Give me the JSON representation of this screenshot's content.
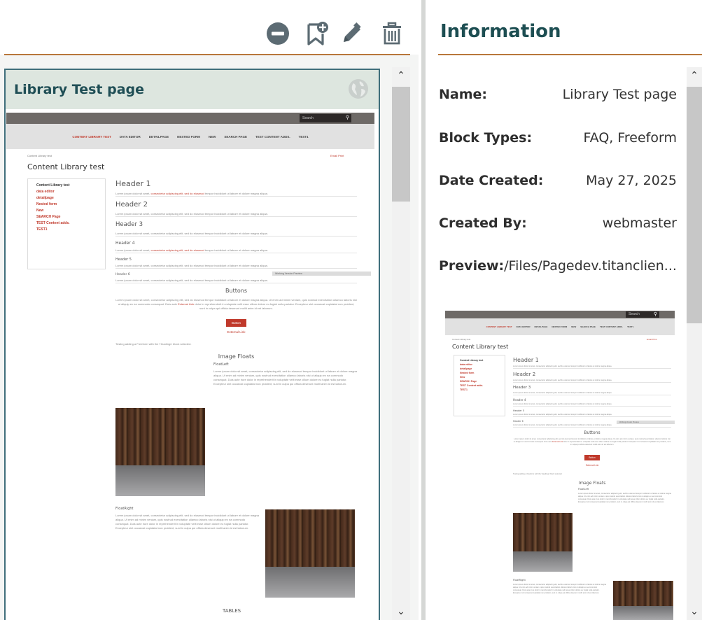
{
  "toolbar": {
    "icons": [
      "minus-circle-icon",
      "bookmark-add-icon",
      "pencil-icon",
      "trash-icon"
    ]
  },
  "card": {
    "title": "Library Test page",
    "globe_icon": "globe-icon"
  },
  "site": {
    "search_placeholder": "Search",
    "search_icon_glyph": "⚲",
    "nav": [
      "CONTENT LIBRARY TEST",
      "DATA EDITOR",
      "DETAILPAGE",
      "NESTED FORM",
      "NEW",
      "SEARCH PAGE",
      "TEST CONTENT ADDS.",
      "TEST1"
    ],
    "breadcrumb": "Content Library test",
    "utility": "Email  Print",
    "page_title": "Content Library test",
    "sidebar": [
      "Content Library test",
      "data editor",
      "detailpage",
      "Nested form",
      "New",
      "SEARCH Page",
      "TEST Content adds.",
      "TEST1"
    ],
    "headers": [
      "Header 1",
      "Header 2",
      "Header 3",
      "Header 4",
      "Header 5",
      "Header 6"
    ],
    "lorem_plain": "Lorem ipsum dolor sit amet,",
    "lorem_link": "consectetur adipiscing elit, sed do eiusmod",
    "lorem_rest": "tempor incididunt ut labore et dolore magna aliqua.",
    "lorem_full": "Lorem ipsum dolor sit amet, consectetur adipiscing elit, sed do eiusmod tempor incididunt ut labore et dolore magna aliqua.",
    "buttons_heading": "Buttons",
    "buttons_text_a": "Lorem ipsum dolor sit amet, consectetur adipiscing elit, sed do eiusmod tempor incididunt ut labore et dolore magna aliqua. Ut enim ad minim veniam, quis nostrud exercitation ullamco laboris nisi ut aliquip ex ea commodo consequat. Duis aute",
    "buttons_text_link": "External Link",
    "buttons_text_b": "dolor in reprehenderit in voluptate velit esse cillum dolore eu fugiat nulla pariatur. Excepteur sint occaecat cupidatat non proident, sunt in culpa qui officia deserunt mollit anim id est laborum.",
    "button_label": "Button",
    "external_link": "External Link",
    "freeform_note": "Testing adding a Freeform with the 'Headings' block selected.",
    "image_floats_heading": "Image Floats",
    "float_left": "FloatLeft",
    "float_right": "FloatRight",
    "float_text": "Lorem ipsum dolor sit amet, consectetur adipiscing elit, sed do eiusmod tempor incididunt ut labore et dolore magna aliqua. Ut enim ad minim veniam, quis nostrud exercitation ullamco laboris nisi ut aliquip ex ea commodo consequat. Duis aute irure dolor in reprehenderit in voluptate velit esse cillum dolore eu fugiat nulla pariatur. Excepteur sint occaecat cupidatat non proident, sunt in culpa qui officia deserunt mollit anim id est laborum.",
    "tables_heading": "TABLES",
    "tooltip": "Working Version Preview"
  },
  "info": {
    "title": "Information",
    "name_label": "Name:",
    "name_value": "Library Test page",
    "block_types_label": "Block Types:",
    "block_types_value": "FAQ, Freeform",
    "date_created_label": "Date Created:",
    "date_created_value": "May 27, 2025",
    "created_by_label": "Created By:",
    "created_by_value": "webmaster",
    "preview_label": "Preview:",
    "preview_value": "/Files/Pagedev.titanclien..."
  },
  "scroll": {
    "up_glyph": "⌃",
    "down_glyph": "⌄"
  }
}
